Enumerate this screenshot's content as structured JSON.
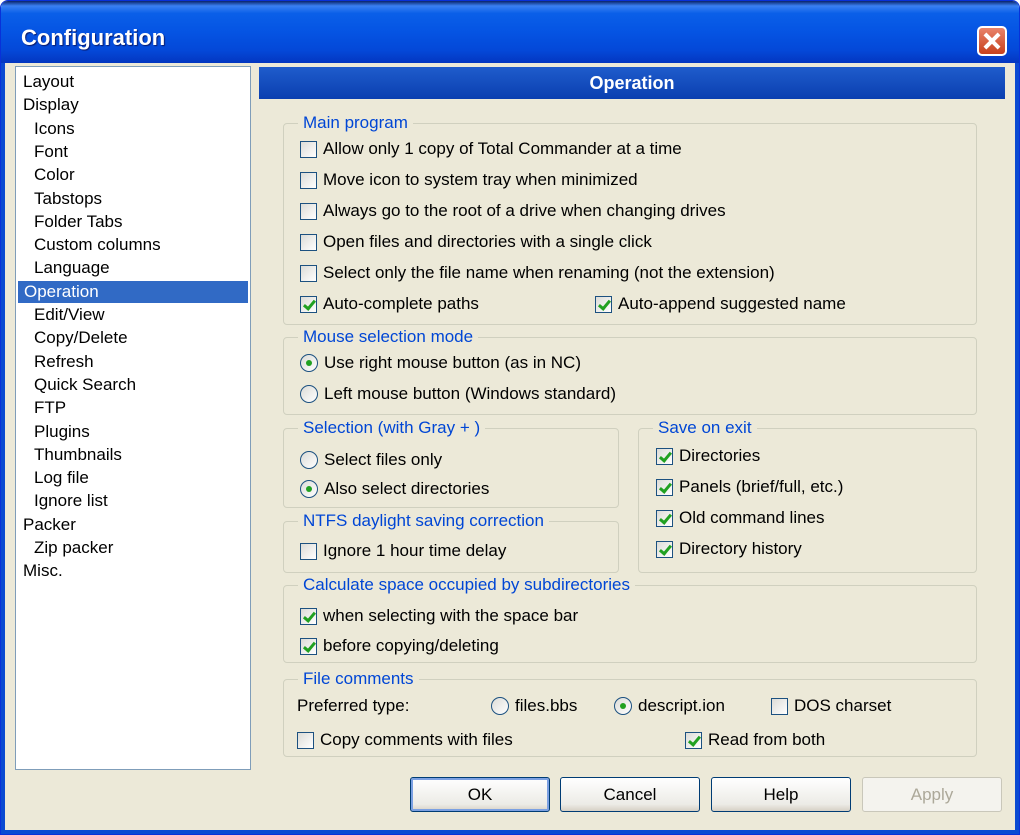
{
  "window": {
    "title": "Configuration"
  },
  "tree": {
    "items": [
      {
        "label": "Layout",
        "level": 0,
        "selected": false
      },
      {
        "label": "Display",
        "level": 0,
        "selected": false
      },
      {
        "label": "Icons",
        "level": 1,
        "selected": false
      },
      {
        "label": "Font",
        "level": 1,
        "selected": false
      },
      {
        "label": "Color",
        "level": 1,
        "selected": false
      },
      {
        "label": "Tabstops",
        "level": 1,
        "selected": false
      },
      {
        "label": "Folder Tabs",
        "level": 1,
        "selected": false
      },
      {
        "label": "Custom columns",
        "level": 1,
        "selected": false
      },
      {
        "label": "Language",
        "level": 1,
        "selected": false
      },
      {
        "label": "Operation",
        "level": 0,
        "selected": true
      },
      {
        "label": "Edit/View",
        "level": 1,
        "selected": false
      },
      {
        "label": "Copy/Delete",
        "level": 1,
        "selected": false
      },
      {
        "label": "Refresh",
        "level": 1,
        "selected": false
      },
      {
        "label": "Quick Search",
        "level": 1,
        "selected": false
      },
      {
        "label": "FTP",
        "level": 1,
        "selected": false
      },
      {
        "label": "Plugins",
        "level": 1,
        "selected": false
      },
      {
        "label": "Thumbnails",
        "level": 1,
        "selected": false
      },
      {
        "label": "Log file",
        "level": 1,
        "selected": false
      },
      {
        "label": "Ignore list",
        "level": 1,
        "selected": false
      },
      {
        "label": "Packer",
        "level": 0,
        "selected": false
      },
      {
        "label": "Zip packer",
        "level": 1,
        "selected": false
      },
      {
        "label": "Misc.",
        "level": 0,
        "selected": false
      }
    ]
  },
  "panel": {
    "header": "Operation"
  },
  "main_program": {
    "title": "Main program",
    "allow_one_copy": {
      "label": "Allow only 1 copy of Total Commander at a time",
      "checked": false
    },
    "tray_icon": {
      "label": "Move icon to system tray when minimized",
      "checked": false
    },
    "root_drive": {
      "label": "Always go to the root of a drive when changing drives",
      "checked": false
    },
    "single_click": {
      "label": "Open files and directories with a single click",
      "checked": false
    },
    "rename_name_only": {
      "label": "Select only the file name when renaming (not the extension)",
      "checked": false
    },
    "auto_complete": {
      "label": "Auto-complete paths",
      "checked": true
    },
    "auto_append": {
      "label": "Auto-append suggested name",
      "checked": true
    }
  },
  "mouse_mode": {
    "title": "Mouse selection mode",
    "right_button": {
      "label": "Use right mouse button (as in NC)",
      "checked": true
    },
    "left_button": {
      "label": "Left mouse button (Windows standard)",
      "checked": false
    }
  },
  "selection_gray": {
    "title": "Selection (with Gray + )",
    "files_only": {
      "label": "Select files only",
      "checked": false
    },
    "also_dirs": {
      "label": "Also select directories",
      "checked": true
    }
  },
  "save_on_exit": {
    "title": "Save on exit",
    "directories": {
      "label": "Directories",
      "checked": true
    },
    "panels": {
      "label": "Panels (brief/full, etc.)",
      "checked": true
    },
    "old_cmdlines": {
      "label": "Old command lines",
      "checked": true
    },
    "dir_history": {
      "label": "Directory history",
      "checked": true
    }
  },
  "ntfs": {
    "title": "NTFS daylight saving correction",
    "ignore_hour": {
      "label": "Ignore 1 hour time delay",
      "checked": false
    }
  },
  "calc_space": {
    "title": "Calculate space occupied by subdirectories",
    "space_bar": {
      "label": "when selecting with the space bar",
      "checked": true
    },
    "before_copy": {
      "label": "before copying/deleting",
      "checked": true
    }
  },
  "file_comments": {
    "title": "File comments",
    "preferred_label": "Preferred type:",
    "files_bbs": {
      "label": "files.bbs",
      "checked": false
    },
    "descript_ion": {
      "label": "descript.ion",
      "checked": true
    },
    "dos_charset": {
      "label": "DOS charset",
      "checked": false
    },
    "copy_comments": {
      "label": "Copy comments with files",
      "checked": false
    },
    "read_both": {
      "label": "Read from both",
      "checked": true
    }
  },
  "buttons": {
    "ok": "OK",
    "cancel": "Cancel",
    "help": "Help",
    "apply": "Apply"
  },
  "colors": {
    "titlebar": "#0554e3",
    "selection": "#316ac5",
    "group_title": "#0046d5",
    "check": "#21a121"
  }
}
